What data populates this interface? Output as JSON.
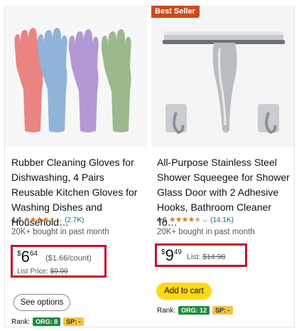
{
  "colors": {
    "accent_price_box": "#c8102e",
    "badge_bg": "#cc4b19",
    "star": "#de7921",
    "link": "#007185",
    "cart_button": "#ffd814",
    "org_tag": "#1f8a3c",
    "sp_tag": "#f4c242"
  },
  "products": [
    {
      "image_icon": "rubber-gloves-image",
      "title": "Rubber Cleaning Gloves for Dishwashing, 4 Pairs Reusable Kitchen Gloves for Washing Dishes and Household…",
      "rating": "4.4",
      "stars_filled": 4.4,
      "review_count": "(2.7K)",
      "bought": "20K+ bought in past month",
      "price_currency": "$",
      "price_whole": "6",
      "price_fraction": "64",
      "unit_price": "($1.66/count)",
      "list_label": "List Price:",
      "list_value": "$9.99",
      "button_label": "See options",
      "rank_label": "Rank:",
      "rank_org": "ORG: 8",
      "rank_sp": "SP: -"
    },
    {
      "badge": "Best Seller",
      "image_icon": "shower-squeegee-image",
      "title": "All-Purpose Stainless Steel Shower Squeegee for Shower Glass Door with 2 Adhesive Hooks, Bathroom Cleaner To…",
      "rating": "4.6",
      "stars_filled": 4.6,
      "review_count": "(14.1K)",
      "bought": "20K+ bought in past month",
      "price_currency": "$",
      "price_whole": "9",
      "price_fraction": "49",
      "list_label": "List:",
      "list_value": "$14.98",
      "button_label": "Add to cart",
      "rank_label": "Rank:",
      "rank_org": "ORG: 12",
      "rank_sp": "SP: -"
    }
  ]
}
